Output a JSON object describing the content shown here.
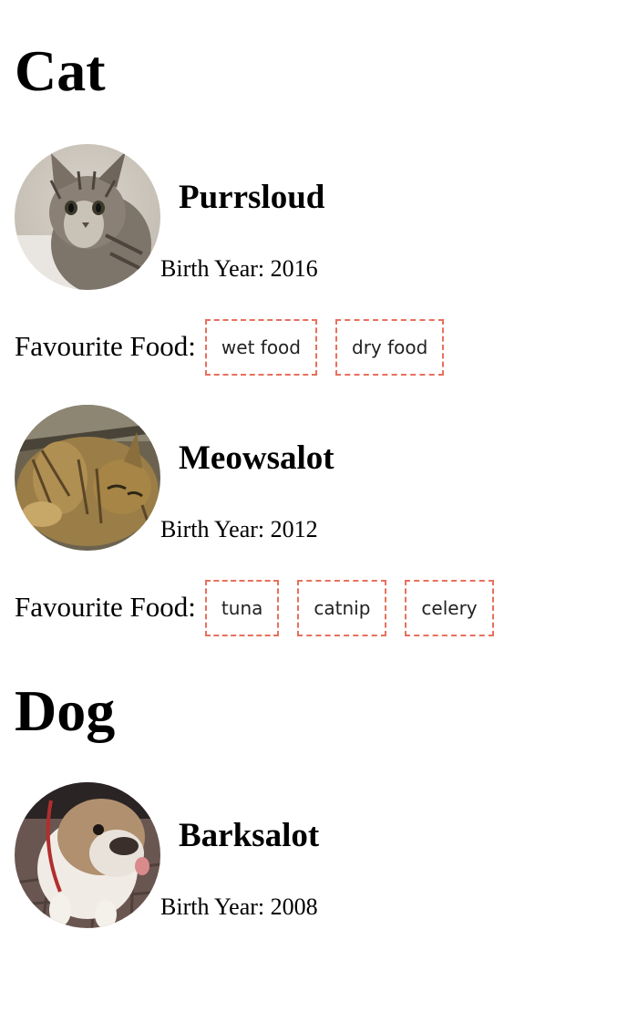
{
  "sections": [
    {
      "title": "Cat",
      "pets": [
        {
          "name": "Purrsloud",
          "birth_label": "Birth Year: 2016",
          "food_label": "Favourite Food:",
          "foods": [
            "wet food",
            "dry food"
          ],
          "photo": "kitten-photo"
        },
        {
          "name": "Meowsalot",
          "birth_label": "Birth Year: 2012",
          "food_label": "Favourite Food:",
          "foods": [
            "tuna",
            "catnip",
            "celery"
          ],
          "photo": "tabby-cat-photo"
        }
      ]
    },
    {
      "title": "Dog",
      "pets": [
        {
          "name": "Barksalot",
          "birth_label": "Birth Year: 2008",
          "photo": "bulldog-photo"
        }
      ]
    }
  ],
  "colors": {
    "tag_border": "#e8705d",
    "text": "#000000",
    "tag_text": "#222222"
  }
}
